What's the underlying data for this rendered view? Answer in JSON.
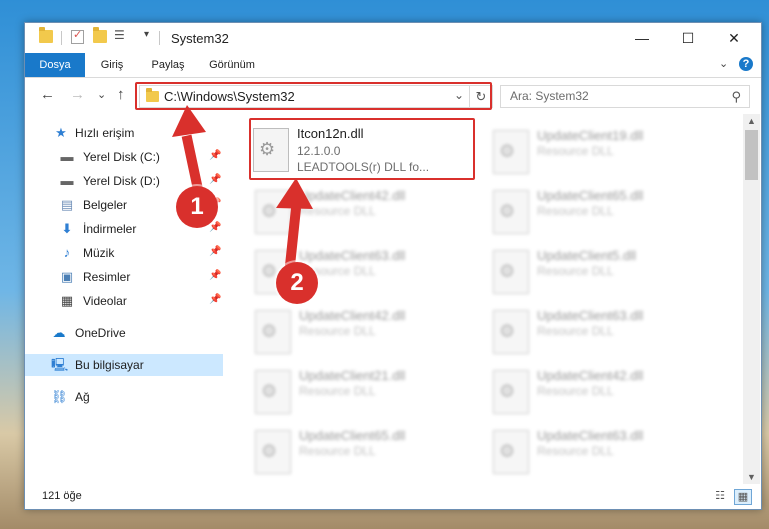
{
  "window": {
    "title": "System32",
    "controls": {
      "minimize": "—",
      "maximize": "☐",
      "close": "✕"
    }
  },
  "ribbon": {
    "tabs": [
      {
        "label": "Dosya",
        "active": true
      },
      {
        "label": "Giriş"
      },
      {
        "label": "Paylaş"
      },
      {
        "label": "Görünüm"
      }
    ],
    "expand": "⌄",
    "help": "?"
  },
  "nav": {
    "back": "←",
    "forward": "→",
    "recent": "⌄",
    "up": "↑"
  },
  "address": {
    "path": "C:\\Windows\\System32",
    "dropdown": "⌄",
    "refresh": "↻"
  },
  "search": {
    "placeholder": "Ara: System32",
    "icon": "search-icon"
  },
  "sidebar": {
    "items": [
      {
        "label": "Hızlı erişim",
        "icon": "star-icon",
        "pinned": false,
        "selected": false
      },
      {
        "label": "Yerel Disk (C:)",
        "icon": "drive-icon",
        "pinned": true,
        "selected": false
      },
      {
        "label": "Yerel Disk (D:)",
        "icon": "drive-icon",
        "pinned": true,
        "selected": false
      },
      {
        "label": "Belgeler",
        "icon": "documents-icon",
        "pinned": true,
        "selected": false
      },
      {
        "label": "İndirmeler",
        "icon": "download-icon",
        "pinned": true,
        "selected": false
      },
      {
        "label": "Müzik",
        "icon": "music-icon",
        "pinned": true,
        "selected": false
      },
      {
        "label": "Resimler",
        "icon": "pictures-icon",
        "pinned": true,
        "selected": false
      },
      {
        "label": "Videolar",
        "icon": "video-icon",
        "pinned": true,
        "selected": false
      },
      {
        "label": "OneDrive",
        "icon": "cloud-icon",
        "pinned": false,
        "selected": false
      },
      {
        "label": "Bu bilgisayar",
        "icon": "computer-icon",
        "pinned": false,
        "selected": true
      },
      {
        "label": "Ağ",
        "icon": "network-icon",
        "pinned": false,
        "selected": false
      }
    ]
  },
  "files": {
    "highlighted": {
      "name": "Itcon12n.dll",
      "version": "12.1.0.0",
      "description": "LEADTOOLS(r) DLL fo..."
    },
    "items": [
      {
        "name": "UpdateClient19.dll",
        "type": "Resource DLL"
      },
      {
        "name": "UpdateClient42.dll",
        "type": "Resource DLL"
      },
      {
        "name": "UpdateClient65.dll",
        "type": "Resource DLL"
      },
      {
        "name": "UpdateClient63.dll",
        "type": "Resource DLL"
      },
      {
        "name": "UpdateClient5.dll",
        "type": "Resource DLL"
      },
      {
        "name": "UpdateClient42.dll",
        "type": "Resource DLL"
      },
      {
        "name": "UpdateClient63.dll",
        "type": "Resource DLL"
      },
      {
        "name": "UpdateClient21.dll",
        "type": "Resource DLL"
      },
      {
        "name": "UpdateClient42.dll",
        "type": "Resource DLL"
      },
      {
        "name": "UpdateClient65.dll",
        "type": "Resource DLL"
      },
      {
        "name": "UpdateClient63.dll",
        "type": "Resource DLL"
      }
    ]
  },
  "status": {
    "count": "121 öğe"
  },
  "annotations": {
    "marker1": "1",
    "marker2": "2",
    "color": "#d9302c"
  },
  "colors": {
    "accent": "#1979ca",
    "selection": "#cce8ff",
    "highlight": "#d9302c"
  }
}
